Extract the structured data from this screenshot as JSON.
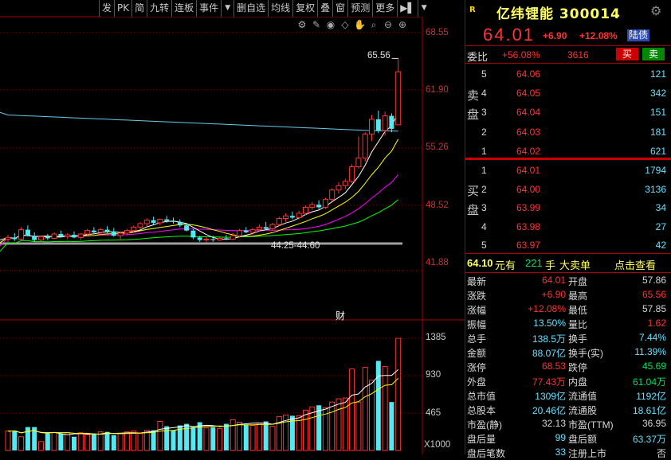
{
  "toolbar": {
    "items": [
      "发",
      "PK",
      "简",
      "九转",
      "连板",
      "事件",
      "▼",
      "删自选",
      "均线",
      "复权",
      "叠",
      "窗",
      "预测",
      "更多",
      "▶▌",
      "▼"
    ]
  },
  "price_axis": [
    "68.55",
    "61.90",
    "55.26",
    "48.52",
    "41.88"
  ],
  "volume_axis": [
    "1385",
    "930",
    "465"
  ],
  "volume_unit": "X1000",
  "annotations": {
    "high_label": "65.56",
    "low_range": "44.25-44.60",
    "cai_marker": "财"
  },
  "quote": {
    "badge": "R",
    "name": "亿纬锂能 300014",
    "price": "64.01",
    "change": "+6.90",
    "change_pct": "+12.08%",
    "tag": "陆债"
  },
  "weibi": {
    "label": "委比",
    "pct": "+56.08%",
    "diff": "3616",
    "buy_btn": "买",
    "sell_btn": "卖"
  },
  "sell_label": "卖盘",
  "buy_label": "买盘",
  "asks": [
    {
      "lvl": "5",
      "price": "64.06",
      "vol": "121"
    },
    {
      "lvl": "4",
      "price": "64.05",
      "vol": "342"
    },
    {
      "lvl": "3",
      "price": "64.04",
      "vol": "151"
    },
    {
      "lvl": "2",
      "price": "64.03",
      "vol": "181"
    },
    {
      "lvl": "1",
      "price": "64.02",
      "vol": "621"
    }
  ],
  "bids": [
    {
      "lvl": "1",
      "price": "64.01",
      "vol": "1794"
    },
    {
      "lvl": "2",
      "price": "64.00",
      "vol": "3136"
    },
    {
      "lvl": "3",
      "price": "63.99",
      "vol": "34"
    },
    {
      "lvl": "4",
      "price": "63.98",
      "vol": "27"
    },
    {
      "lvl": "5",
      "price": "63.97",
      "vol": "42"
    }
  ],
  "big_order": {
    "price": "64.10",
    "unit1": "元有",
    "qty": "221",
    "unit2": "手",
    "label": "大卖单",
    "link": "点击查看"
  },
  "stats": [
    {
      "l1": "最新",
      "v1": "64.01",
      "c1": "red",
      "l2": "开盘",
      "v2": "57.86",
      "c2": "white"
    },
    {
      "l1": "涨跌",
      "v1": "+6.90",
      "c1": "red",
      "l2": "最高",
      "v2": "65.56",
      "c2": "red"
    },
    {
      "l1": "涨幅",
      "v1": "+12.08%",
      "c1": "red",
      "l2": "最低",
      "v2": "57.85",
      "c2": "white"
    },
    {
      "l1": "振幅",
      "v1": "13.50%",
      "c1": "cyan",
      "l2": "量比",
      "v2": "1.62",
      "c2": "red"
    },
    {
      "l1": "总手",
      "v1": "138.5万",
      "c1": "cyan",
      "l2": "换手",
      "v2": "7.44%",
      "c2": "cyan"
    },
    {
      "l1": "金额",
      "v1": "88.07亿",
      "c1": "cyan",
      "l2": "换手(实)",
      "v2": "11.39%",
      "c2": "cyan"
    },
    {
      "l1": "涨停",
      "v1": "68.53",
      "c1": "red",
      "l2": "跌停",
      "v2": "45.69",
      "c2": "green"
    },
    {
      "l1": "外盘",
      "v1": "77.43万",
      "c1": "red",
      "l2": "内盘",
      "v2": "61.04万",
      "c2": "green"
    },
    {
      "l1": "总市值",
      "v1": "1309亿",
      "c1": "cyan",
      "l2": "流通值",
      "v2": "1192亿",
      "c2": "cyan"
    },
    {
      "l1": "总股本",
      "v1": "20.46亿",
      "c1": "cyan",
      "l2": "流通股",
      "v2": "18.61亿",
      "c2": "cyan"
    },
    {
      "l1": "市盈(静)",
      "v1": "32.13",
      "c1": "white",
      "l2": "市盈(TTM)",
      "v2": "36.95",
      "c2": "white"
    },
    {
      "l1": "盘后量",
      "v1": "99",
      "c1": "cyan",
      "l2": "盘后额",
      "v2": "63.37万",
      "c2": "cyan"
    },
    {
      "l1": "盘后笔数",
      "v1": "33",
      "c1": "cyan",
      "l2": "注册上市",
      "v2": "否",
      "c2": "white"
    }
  ],
  "colors": {
    "up": "#ff3333",
    "down": "#54e8f0",
    "ma5": "#ffffff",
    "ma10": "#ffff00",
    "ma20": "#ff00ff",
    "ma30": "#00ff00",
    "ma60": "#a0a0a0",
    "ma250": "#66ccee"
  },
  "chart_data": {
    "type": "candlestick",
    "y_range": [
      41.88,
      68.55
    ],
    "candles": [
      [
        44.6,
        45.1,
        44.2,
        44.8
      ],
      [
        44.8,
        45.3,
        44.4,
        44.6
      ],
      [
        44.6,
        46.0,
        44.5,
        45.7
      ],
      [
        45.7,
        46.2,
        44.9,
        45.0
      ],
      [
        45.0,
        45.4,
        44.3,
        44.5
      ],
      [
        44.5,
        45.0,
        44.1,
        44.9
      ],
      [
        44.9,
        45.2,
        44.5,
        44.7
      ],
      [
        44.7,
        45.4,
        44.6,
        45.2
      ],
      [
        45.2,
        45.6,
        44.8,
        44.9
      ],
      [
        44.9,
        45.3,
        44.6,
        45.1
      ],
      [
        45.1,
        45.5,
        44.7,
        44.8
      ],
      [
        44.8,
        45.3,
        44.5,
        45.2
      ],
      [
        45.2,
        45.8,
        45.0,
        45.6
      ],
      [
        45.6,
        46.0,
        45.2,
        45.4
      ],
      [
        45.4,
        45.9,
        45.1,
        45.7
      ],
      [
        45.7,
        46.1,
        45.3,
        45.5
      ],
      [
        45.5,
        45.9,
        44.9,
        45.0
      ],
      [
        45.0,
        45.4,
        44.6,
        45.3
      ],
      [
        45.3,
        45.8,
        45.0,
        45.6
      ],
      [
        45.6,
        46.2,
        45.4,
        46.0
      ],
      [
        46.0,
        46.6,
        45.7,
        46.4
      ],
      [
        46.4,
        47.0,
        46.1,
        46.8
      ],
      [
        46.8,
        47.2,
        46.3,
        46.5
      ],
      [
        46.5,
        47.0,
        46.2,
        46.9
      ],
      [
        46.9,
        47.3,
        46.5,
        46.7
      ],
      [
        46.7,
        47.1,
        46.4,
        46.6
      ],
      [
        46.6,
        46.9,
        46.0,
        46.2
      ],
      [
        46.2,
        46.5,
        45.5,
        45.6
      ],
      [
        45.6,
        45.8,
        44.6,
        44.8
      ],
      [
        44.8,
        45.0,
        44.3,
        44.5
      ],
      [
        44.5,
        44.9,
        44.25,
        44.6
      ],
      [
        44.6,
        45.0,
        44.3,
        44.5
      ],
      [
        44.5,
        44.9,
        44.4,
        44.7
      ],
      [
        44.7,
        45.1,
        44.5,
        44.6
      ],
      [
        44.6,
        45.3,
        44.5,
        45.0
      ],
      [
        45.0,
        45.8,
        44.8,
        45.6
      ],
      [
        45.6,
        46.0,
        45.3,
        45.4
      ],
      [
        45.4,
        45.9,
        45.1,
        45.7
      ],
      [
        45.7,
        46.3,
        45.5,
        46.0
      ],
      [
        46.0,
        46.6,
        45.7,
        45.8
      ],
      [
        45.8,
        46.5,
        45.6,
        46.3
      ],
      [
        46.3,
        47.2,
        46.1,
        47.0
      ],
      [
        47.0,
        47.6,
        46.6,
        47.3
      ],
      [
        47.3,
        47.8,
        46.9,
        47.1
      ],
      [
        47.1,
        47.9,
        46.9,
        47.6
      ],
      [
        47.6,
        48.5,
        47.4,
        48.3
      ],
      [
        48.3,
        48.9,
        48.0,
        48.6
      ],
      [
        48.6,
        49.1,
        48.1,
        48.3
      ],
      [
        48.3,
        49.4,
        48.1,
        49.2
      ],
      [
        49.2,
        50.5,
        49.0,
        50.3
      ],
      [
        50.3,
        51.2,
        49.9,
        50.8
      ],
      [
        50.8,
        51.6,
        50.4,
        51.3
      ],
      [
        51.3,
        53.3,
        51.1,
        53.0
      ],
      [
        53.0,
        56.5,
        52.8,
        54.0
      ],
      [
        54.0,
        57.0,
        53.6,
        56.8
      ],
      [
        56.8,
        59.0,
        56.0,
        58.5
      ],
      [
        58.5,
        59.5,
        56.9,
        57.2
      ],
      [
        57.2,
        59.4,
        56.6,
        58.9
      ],
      [
        58.9,
        59.2,
        57.0,
        57.4
      ],
      [
        57.86,
        65.56,
        57.85,
        64.01
      ]
    ],
    "volumes": [
      240,
      245,
      170,
      290,
      290,
      110,
      210,
      220,
      210,
      220,
      170,
      220,
      195,
      210,
      230,
      230,
      190,
      210,
      230,
      240,
      210,
      250,
      250,
      360,
      300,
      250,
      310,
      330,
      290,
      350,
      280,
      290,
      270,
      330,
      380,
      350,
      320,
      310,
      340,
      360,
      300,
      420,
      440,
      430,
      430,
      500,
      540,
      560,
      530,
      600,
      640,
      650,
      1010,
      600,
      1030,
      870,
      1110,
      1040,
      600,
      1390
    ],
    "vol_max": 1460
  }
}
